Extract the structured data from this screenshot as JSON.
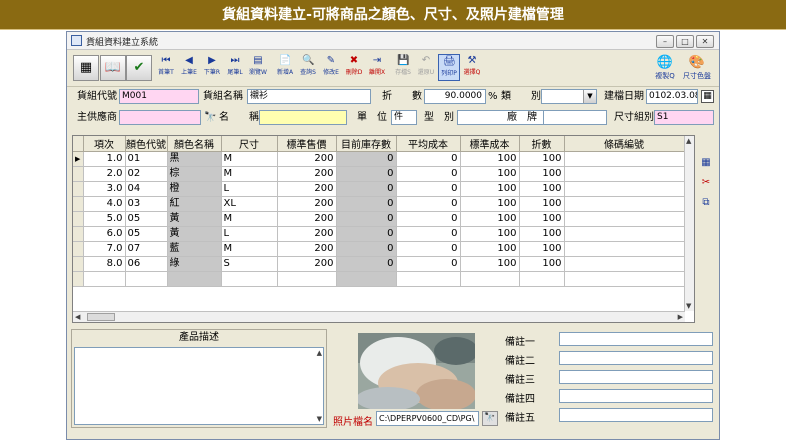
{
  "banner": {
    "title": "貨組資料建立-可將商品之顏色、尺寸、及照片建檔管理"
  },
  "window": {
    "title": "貨組資料建立系統",
    "min": "–",
    "max": "□",
    "close": "✕",
    "icon": "🗒"
  },
  "toolbar": {
    "left_icons": [
      {
        "name": "calculator-icon",
        "glyph": "▦"
      },
      {
        "name": "book-icon",
        "glyph": "📖"
      },
      {
        "name": "approve-icon",
        "glyph": "✔"
      }
    ],
    "buttons": [
      {
        "glyph": "⏮",
        "label": "首筆T"
      },
      {
        "glyph": "◀",
        "label": "上筆E"
      },
      {
        "glyph": "▶",
        "label": "下筆R"
      },
      {
        "glyph": "⏭",
        "label": "尾筆L"
      },
      {
        "glyph": "▤",
        "label": "瀏覽W"
      },
      {
        "glyph": "📄",
        "label": "新增A"
      },
      {
        "glyph": "🔍",
        "label": "查詢S"
      },
      {
        "glyph": "✎",
        "label": "修改E"
      },
      {
        "glyph": "✖",
        "label": "刪除D"
      },
      {
        "glyph": "⇥",
        "label": "離開X"
      },
      {
        "glyph": "💾",
        "label": "存檔S"
      },
      {
        "glyph": "↶",
        "label": "還原U"
      },
      {
        "glyph": "🖨",
        "label": "列印P"
      },
      {
        "glyph": "⚒",
        "label": "選擇Q"
      }
    ],
    "right": [
      {
        "glyph": "🌐",
        "label": "複製Q"
      },
      {
        "glyph": "🎨",
        "label": "尺寸色盤"
      }
    ]
  },
  "form": {
    "code_label": "貨組代號",
    "code_value": "M001",
    "name_label": "貨組名稱",
    "name_value": "襯衫",
    "discount_label": "折　　數",
    "discount_value": "90.0000",
    "discount_unit": "%",
    "category_label": "類　　別",
    "category_value": "",
    "created_label": "建檔日期",
    "created_value": "0102.03.08",
    "calendar_icon": "▦",
    "supplier_label": "主供應商",
    "supplier_value": "",
    "binoculars_icon": "🔭",
    "sname_label": "名　　稱",
    "sname_value": "",
    "unit_label": "單　位",
    "unit_value": "件",
    "model_label": "型　別",
    "model_value": "",
    "brand_label": "廠　牌",
    "brand_value": "",
    "sizegroup_label": "尺寸組別",
    "sizegroup_value": "S1"
  },
  "grid": {
    "columns": [
      "項次",
      "顏色代號",
      "顏色名稱",
      "尺寸",
      "標準售價",
      "目前庫存數",
      "平均成本",
      "標準成本",
      "折數",
      "條碼編號"
    ],
    "current_marker": "▶",
    "rows": [
      [
        "1.0",
        "01",
        "黑",
        "M",
        "200",
        "0",
        "0",
        "100",
        "100",
        ""
      ],
      [
        "2.0",
        "02",
        "棕",
        "M",
        "200",
        "0",
        "0",
        "100",
        "100",
        ""
      ],
      [
        "3.0",
        "04",
        "橙",
        "L",
        "200",
        "0",
        "0",
        "100",
        "100",
        ""
      ],
      [
        "4.0",
        "03",
        "紅",
        "XL",
        "200",
        "0",
        "0",
        "100",
        "100",
        ""
      ],
      [
        "5.0",
        "05",
        "黃",
        "M",
        "200",
        "0",
        "0",
        "100",
        "100",
        ""
      ],
      [
        "6.0",
        "05",
        "黃",
        "L",
        "200",
        "0",
        "0",
        "100",
        "100",
        ""
      ],
      [
        "7.0",
        "07",
        "藍",
        "M",
        "200",
        "0",
        "0",
        "100",
        "100",
        ""
      ],
      [
        "8.0",
        "06",
        "綠",
        "S",
        "200",
        "0",
        "0",
        "100",
        "100",
        ""
      ]
    ]
  },
  "side_icons": [
    "▦",
    "✂",
    "⧉"
  ],
  "description": {
    "title": "產品描述"
  },
  "photo": {
    "label": "照片檔名",
    "file": "C:\\DPERPV0600_CD\\PG\\",
    "browse_icon": "🔭"
  },
  "remarks": [
    "備註一",
    "備註二",
    "備註三",
    "備註四",
    "備註五"
  ]
}
